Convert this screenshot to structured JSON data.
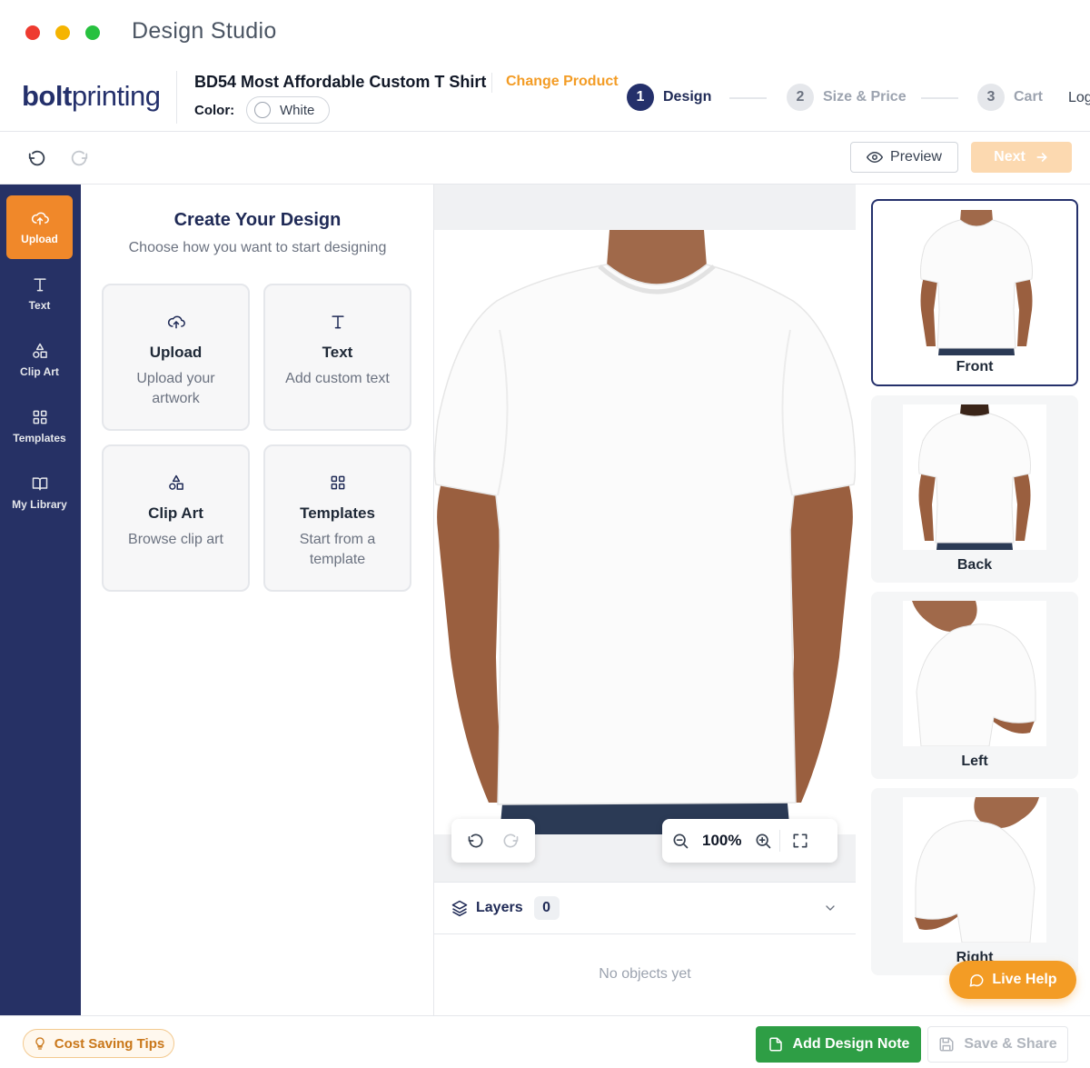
{
  "window": {
    "title": "Design Studio"
  },
  "header": {
    "logo_bold": "bolt",
    "logo_light": "printing",
    "product_name": "BD54 Most Affordable Custom T Shirt",
    "change_product": "Change Product",
    "color_label": "Color:",
    "color_value": "White",
    "steps": [
      {
        "num": "1",
        "label": "Design",
        "state": "active"
      },
      {
        "num": "2",
        "label": "Size & Price",
        "state": "inactive"
      },
      {
        "num": "3",
        "label": "Cart",
        "state": "inactive"
      }
    ],
    "login_partial": "Log"
  },
  "toolbar": {
    "preview_label": "Preview",
    "next_label": "Next"
  },
  "sidebar": {
    "items": [
      {
        "label": "Upload",
        "icon": "upload-cloud-icon",
        "active": true
      },
      {
        "label": "Text",
        "icon": "text-icon",
        "active": false
      },
      {
        "label": "Clip Art",
        "icon": "shapes-icon",
        "active": false
      },
      {
        "label": "Templates",
        "icon": "grid-icon",
        "active": false
      },
      {
        "label": "My Library",
        "icon": "book-icon",
        "active": false
      }
    ]
  },
  "design_panel": {
    "title": "Create Your Design",
    "subtitle": "Choose how you want to start designing",
    "options": [
      {
        "title": "Upload",
        "desc": "Upload your artwork",
        "icon": "upload-cloud-icon"
      },
      {
        "title": "Text",
        "desc": "Add custom text",
        "icon": "text-icon"
      },
      {
        "title": "Clip Art",
        "desc": "Browse clip art",
        "icon": "shapes-icon"
      },
      {
        "title": "Templates",
        "desc": "Start from a template",
        "icon": "grid-icon"
      }
    ]
  },
  "canvas": {
    "zoom": "100%"
  },
  "layers": {
    "title": "Layers",
    "count": "0",
    "empty_text": "No objects yet"
  },
  "views": {
    "items": [
      {
        "label": "Front",
        "active": true
      },
      {
        "label": "Back",
        "active": false
      },
      {
        "label": "Left",
        "active": false
      },
      {
        "label": "Right",
        "active": false
      }
    ]
  },
  "live_help": {
    "label": "Live Help"
  },
  "bottom": {
    "tips_label": "Cost Saving Tips",
    "note_label": "Add Design Note",
    "share_label": "Save & Share"
  },
  "colors": {
    "navy": "#263165",
    "orange": "#f0882a",
    "green": "#2e9e45"
  }
}
